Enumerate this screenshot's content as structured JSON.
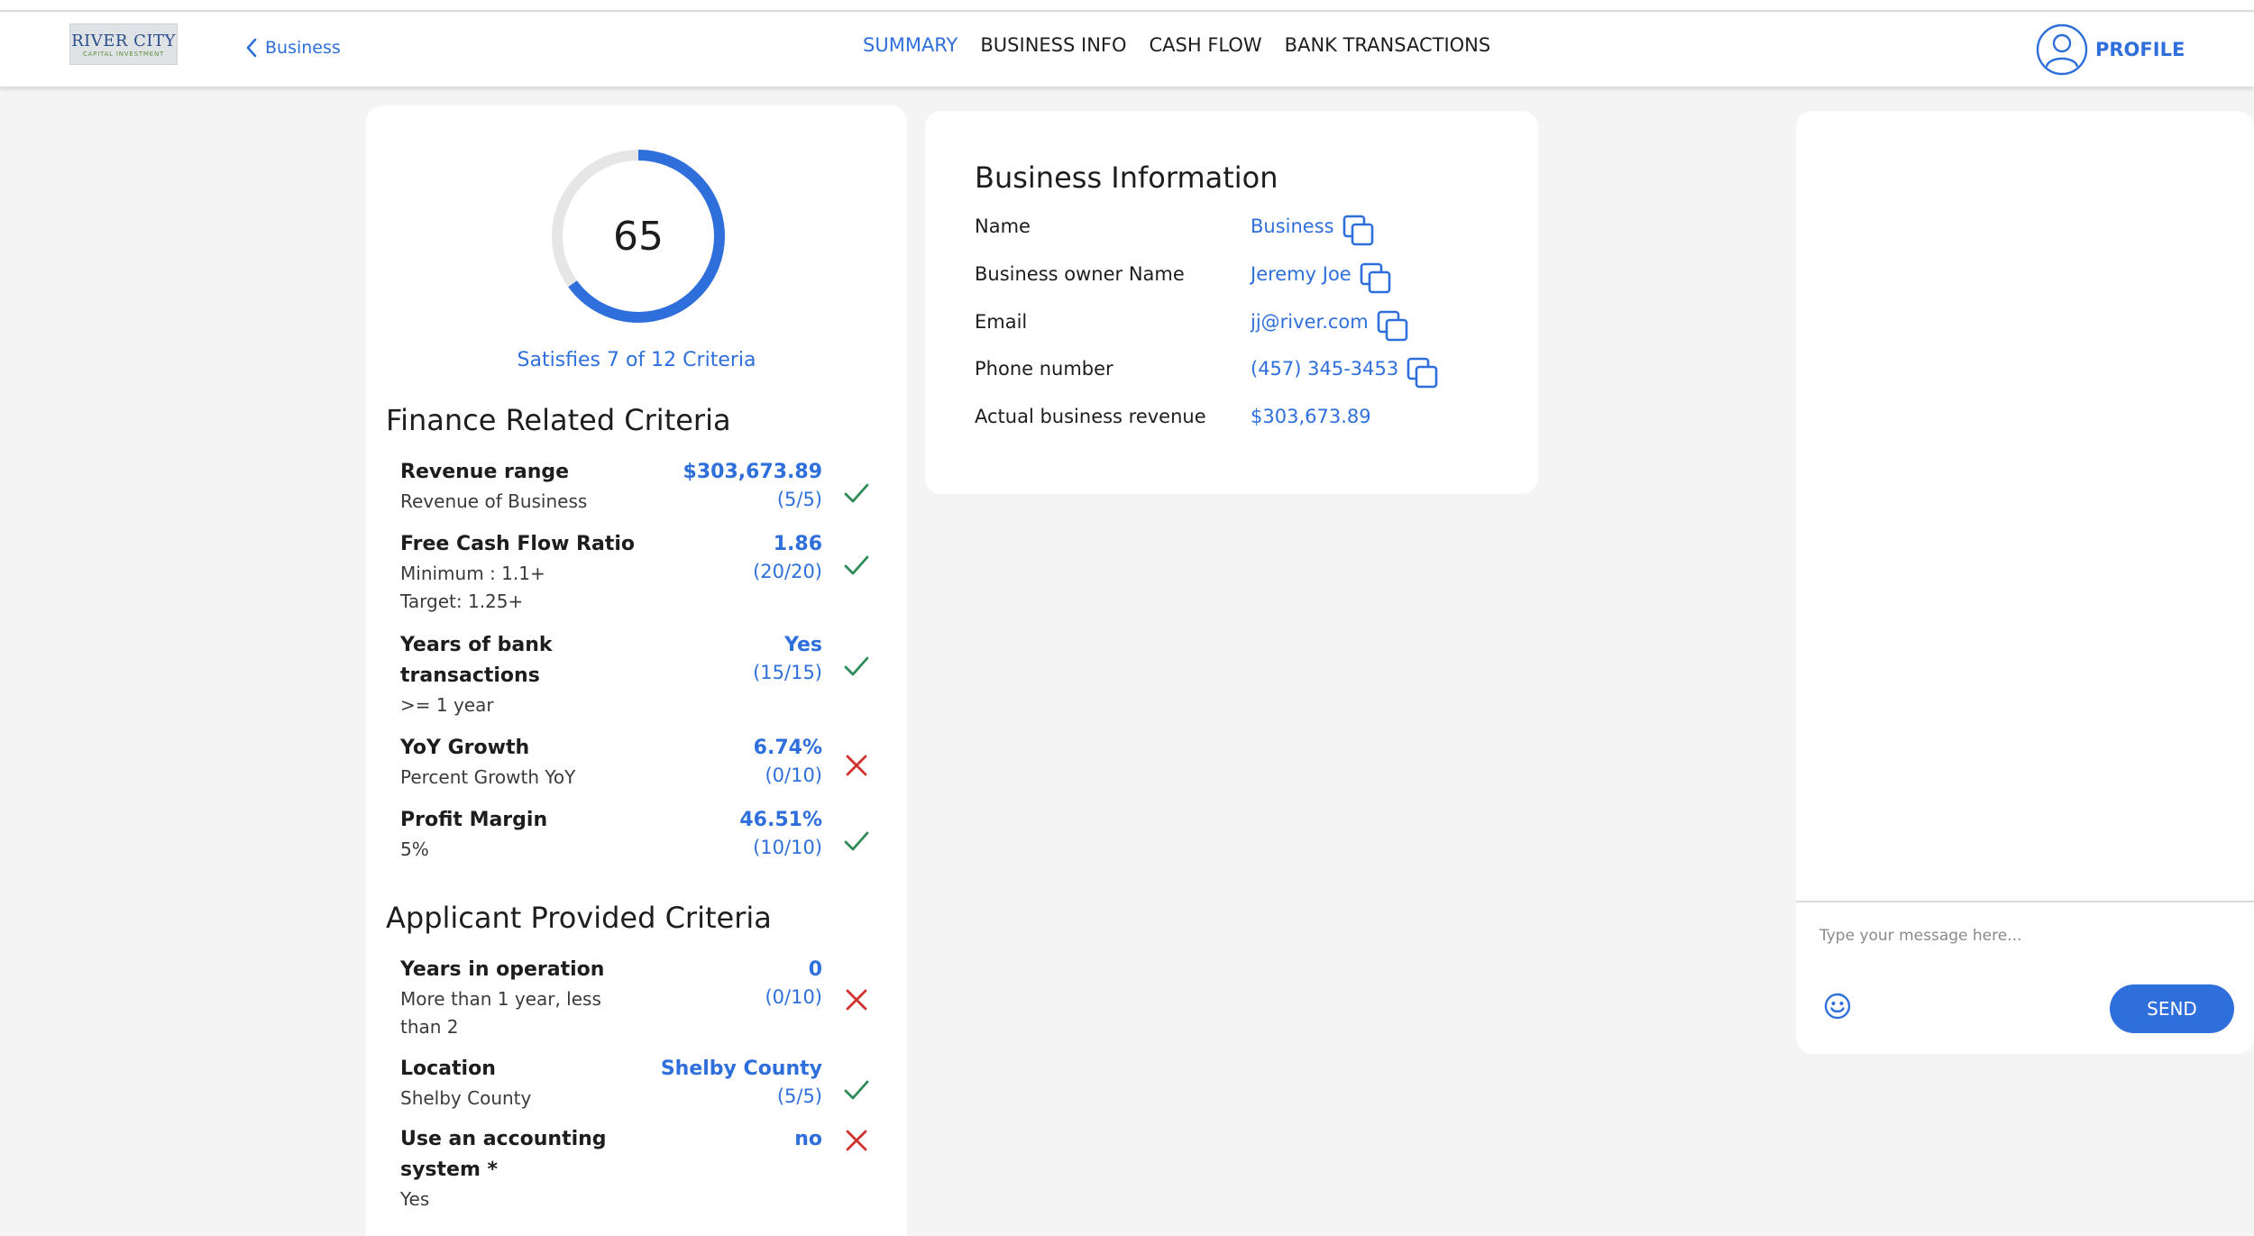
{
  "app": {
    "logo_text": "RIVER CITY",
    "logo_subtext": "CAPITAL INVESTMENT"
  },
  "header": {
    "back_label": "Business",
    "tabs": [
      {
        "label": "SUMMARY",
        "active": true
      },
      {
        "label": "BUSINESS INFO",
        "active": false
      },
      {
        "label": "CASH FLOW",
        "active": false
      },
      {
        "label": "BANK TRANSACTIONS",
        "active": false
      }
    ],
    "profile_label": "PROFILE"
  },
  "score": {
    "value": "65",
    "max": 100,
    "satisfies_text": "Satisfies 7 of 12 Criteria"
  },
  "finance_section": {
    "title": "Finance Related Criteria",
    "items": [
      {
        "title": "Revenue range",
        "subs": [
          "Revenue of Business"
        ],
        "value": "$303,673.89",
        "points": "(5/5)",
        "status": "pass"
      },
      {
        "title": "Free Cash Flow Ratio",
        "subs": [
          "Minimum : 1.1+",
          "Target: 1.25+"
        ],
        "value": "1.86",
        "points": "(20/20)",
        "status": "pass"
      },
      {
        "title": "Years of bank transactions",
        "subs": [
          ">= 1 year"
        ],
        "value": "Yes",
        "points": "(15/15)",
        "status": "pass"
      },
      {
        "title": "YoY Growth",
        "subs": [
          "Percent Growth YoY"
        ],
        "value": "6.74%",
        "points": "(0/10)",
        "status": "fail"
      },
      {
        "title": "Profit Margin",
        "subs": [
          "5%"
        ],
        "value": "46.51%",
        "points": "(10/10)",
        "status": "pass"
      }
    ]
  },
  "applicant_section": {
    "title": "Applicant Provided Criteria",
    "items": [
      {
        "title": "Years in operation",
        "subs": [
          "More than 1 year, less than 2"
        ],
        "value": "0",
        "points": "(0/10)",
        "status": "fail"
      },
      {
        "title": "Location",
        "subs": [
          "Shelby County"
        ],
        "value": "Shelby County",
        "points": "(5/5)",
        "status": "pass"
      },
      {
        "title": "Use an accounting system *",
        "subs": [
          "Yes"
        ],
        "value": "no",
        "points": "",
        "status": "fail"
      }
    ]
  },
  "business_info": {
    "title": "Business Information",
    "rows": [
      {
        "label": "Name",
        "value": "Business",
        "copyable": true
      },
      {
        "label": "Business owner Name",
        "value": "Jeremy Joe",
        "copyable": true
      },
      {
        "label": "Email",
        "value": "jj@river.com",
        "copyable": true
      },
      {
        "label": "Phone number",
        "value": "(457) 345-3453",
        "copyable": true
      },
      {
        "label": "Actual business revenue",
        "value": "$303,673.89",
        "copyable": false
      }
    ]
  },
  "chat": {
    "placeholder": "Type your message here...",
    "send_label": "SEND",
    "emoji_icon": "smiley-icon"
  },
  "colors": {
    "accent": "#2f6fdc",
    "pass": "#2e8b57",
    "fail": "#d0312d",
    "gauge_track": "#e6e6e6"
  }
}
